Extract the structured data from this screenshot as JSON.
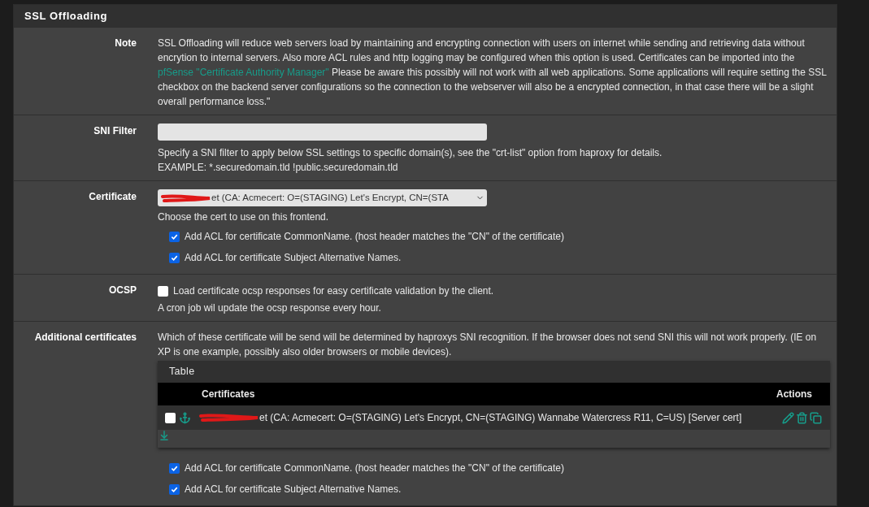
{
  "panel_title": "SSL Offloading",
  "sections": [
    {
      "kind": "note",
      "label": "Note",
      "text_before": "SSL Offloading will reduce web servers load by maintaining and encrypting connection with users on internet while sending and retrieving data without encrytion to internal servers. Also more ACL rules and http logging may be configured when this option is used. Certificates can be imported into the",
      "link": "pfSense \"Certificate Authority Manager\"",
      "text_after": "Please be aware this possibly will not work with all web applications. Some applications will require setting the SSL checkbox on the backend server configurations so the connection to the webserver will also be a encrypted connection, in that case there will be a slight overall performance loss.\""
    },
    {
      "kind": "text_input",
      "label": "SNI Filter",
      "help": [
        "Specify a SNI filter to apply below SSL settings to specific domain(s), see the \"crt-list\" option from haproxy for details.",
        "EXAMPLE: *.securedomain.tld !public.securedomain.tld"
      ]
    },
    {
      "kind": "select",
      "label": "Certificate",
      "value": "et (CA: Acmecert: O=(STAGING) Let's Encrypt, CN=(STA",
      "redacted": true,
      "help": "Choose the cert to use on this frontend.",
      "checkboxes": [
        {
          "label": "Add ACL for certificate CommonName. (host header matches the \"CN\" of the certificate)",
          "checked": true
        },
        {
          "label": "Add ACL for certificate Subject Alternative Names.",
          "checked": true
        }
      ]
    },
    {
      "kind": "checkbox",
      "label": "OCSP",
      "checkbox": {
        "label": "Load certificate ocsp responses for easy certificate validation by the client.",
        "checked": false
      },
      "help": "A cron job wil update the ocsp response every hour."
    },
    {
      "kind": "table",
      "label": "Additional certificates",
      "help": "Which of these certificate will be send will be determined by haproxys SNI recognition. If the browser does not send SNI this will not work properly. (IE on XP is one example, possibly also older browsers or mobile devices).",
      "table": {
        "title": "Table",
        "columns": [
          "Certificates",
          "Actions"
        ],
        "rows": [
          {
            "checked": false,
            "redacted": true,
            "text": "et (CA: Acmecert: O=(STAGING) Let's Encrypt, CN=(STAGING) Wannabe Watercress R11, C=US) [Server cert]"
          }
        ]
      },
      "checkboxes": [
        {
          "label": "Add ACL for certificate CommonName. (host header matches the \"CN\" of the certificate)",
          "checked": true
        },
        {
          "label": "Add ACL for certificate Subject Alternative Names.",
          "checked": true
        }
      ]
    }
  ]
}
